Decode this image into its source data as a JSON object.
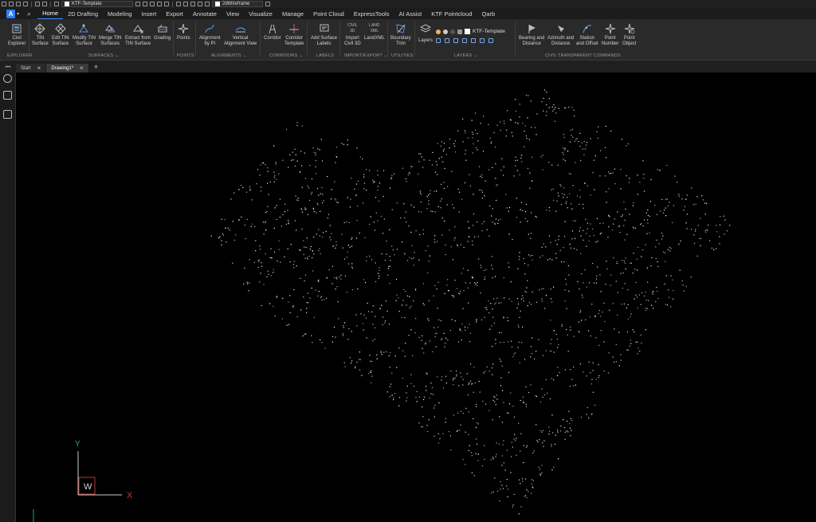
{
  "quick_access": {
    "workspace_value": "KTF-Template",
    "visual_style_value": "2dWireframe"
  },
  "menu": {
    "app_button_label": "A",
    "tabs": [
      "Home",
      "2D Drafting",
      "Modeling",
      "Insert",
      "Export",
      "Annotate",
      "View",
      "Visualize",
      "Manage",
      "Point Cloud",
      "ExpressTools",
      "AI Assist",
      "KTF Pointcloud",
      "Qarb"
    ],
    "active_tab": "Home"
  },
  "ribbon": {
    "buttons": {
      "civil_explorer": "Civil\nExplorer",
      "tin_surface": "TIN\nSurface",
      "edit_tin_surface": "Edit TIN\nSurface",
      "modify_tin_surface": "Modify TIN\nSurface",
      "merge_tin_surfaces": "Merge TIN\nSurfaces",
      "extract_from_tin_surface": "Extract from\nTIN Surface",
      "grading": "Grading",
      "points": "Points",
      "alignment_by_pi": "Alignment\nby PI",
      "vertical_alignment_view": "Vertical\nAlignment View",
      "corridor": "Corridor",
      "corridor_template": "Corridor\nTemplate",
      "add_surface_labels": "Add Surface\nLabels",
      "import_civil_3d": "Import\nCivil 3D",
      "landxml": "LandXML",
      "boundary_trim": "Boundary\nTrim",
      "layers": "Layers",
      "bearing_and_distance": "Bearing and\nDistance",
      "azimuth_and_distance": "Azimuth and\nDistance",
      "station_and_offset": "Station\nand Offset",
      "point_number": "Point\nNumber",
      "point_object": "Point\nObject"
    },
    "icon_captions": {
      "civil_3d": "CIVIL\n3D",
      "land_xml": "LAND\nXML"
    },
    "current_layer": "KTF-Template",
    "groups": {
      "explorer": "EXPLORER",
      "surfaces": "SURFACES ⌄",
      "points": "POINTS",
      "alignments": "ALIGNMENTS ⌄",
      "corridors": "CORRIDORS ⌄",
      "labels": "LABELS",
      "import_export": "IMPORT/EXPORT ⌄",
      "utilities": "UTILITIES",
      "layers": "LAYERS ⌄",
      "civil_transparent": "CIVIL TRANSPARENT COMMANDS"
    }
  },
  "document_tabs": [
    {
      "label": "Start",
      "active": false
    },
    {
      "label": "Drawing1*",
      "active": true
    }
  ],
  "ucs": {
    "x_label": "X",
    "y_label": "Y",
    "w_label": "W"
  },
  "colors": {
    "accent": "#3a8dff",
    "ucs_x": "#c0392b",
    "ucs_y": "#27ae60",
    "points": "#ffffff"
  }
}
